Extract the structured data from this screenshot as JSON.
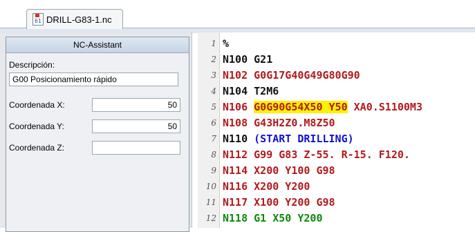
{
  "tab": {
    "filename": "DRILL-G83-1.nc",
    "icon_text": "61"
  },
  "assistant": {
    "title": "NC-Assistant",
    "description_label": "Descripción:",
    "description_value": "G00 Posicionamiento rápido",
    "coord_x_label": "Coordenada X:",
    "coord_x_value": "50",
    "coord_y_label": "Coordenada Y:",
    "coord_y_value": "50",
    "coord_z_label": "Coordenada Z:",
    "coord_z_value": ""
  },
  "colors": {
    "black": "#111111",
    "red": "#b2191c",
    "blue": "#1010d0",
    "green": "#0a8a0a",
    "highlight": "#fff200"
  },
  "editor": {
    "lines": [
      {
        "num": "1",
        "segments": [
          {
            "text": "%",
            "color": "black"
          }
        ]
      },
      {
        "num": "2",
        "segments": [
          {
            "text": "N100 G21",
            "color": "black"
          }
        ]
      },
      {
        "num": "3",
        "segments": [
          {
            "text": "N102 G0G17G40G49G80G90",
            "color": "red"
          }
        ]
      },
      {
        "num": "4",
        "segments": [
          {
            "text": "N104 T2M6",
            "color": "black"
          }
        ]
      },
      {
        "num": "5",
        "segments": [
          {
            "text": "N106 ",
            "color": "red"
          },
          {
            "text": "G0G90G54X50 Y50",
            "color": "red",
            "highlight": true
          },
          {
            "text": " XA0.S1100M3",
            "color": "red"
          }
        ]
      },
      {
        "num": "6",
        "segments": [
          {
            "text": "N108 G43H2Z0.M8Z50",
            "color": "red"
          }
        ]
      },
      {
        "num": "7",
        "segments": [
          {
            "text": "N110 ",
            "color": "black"
          },
          {
            "text": "(START DRILLING)",
            "color": "blue"
          }
        ]
      },
      {
        "num": "8",
        "segments": [
          {
            "text": "N112 G99 G83 Z-55. R-15. F120.",
            "color": "red"
          }
        ]
      },
      {
        "num": "9",
        "segments": [
          {
            "text": "N114 X200 Y100 G98",
            "color": "red"
          }
        ]
      },
      {
        "num": "10",
        "segments": [
          {
            "text": "N116 X200 Y200",
            "color": "red"
          }
        ]
      },
      {
        "num": "11",
        "segments": [
          {
            "text": "N117 X100 Y200 G98",
            "color": "red"
          }
        ]
      },
      {
        "num": "12",
        "segments": [
          {
            "text": "N118 G1 X50 Y200",
            "color": "green"
          }
        ]
      }
    ]
  }
}
